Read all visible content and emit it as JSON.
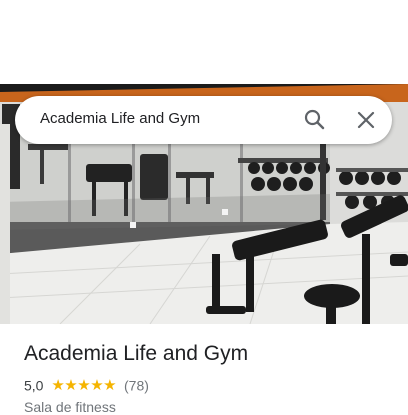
{
  "search": {
    "query": "Academia Life and Gym",
    "search_icon": "search-icon",
    "close_icon": "close-icon"
  },
  "photo": {
    "subject": "gym-interior-photo"
  },
  "place": {
    "name": "Academia Life and Gym",
    "rating": "5,0",
    "stars": "★★★★★",
    "star_count": 5,
    "reviews": "(78)",
    "category": "Sala de fitness"
  },
  "colors": {
    "star": "#f5b400",
    "title": "#202124",
    "secondary": "#70757a"
  }
}
